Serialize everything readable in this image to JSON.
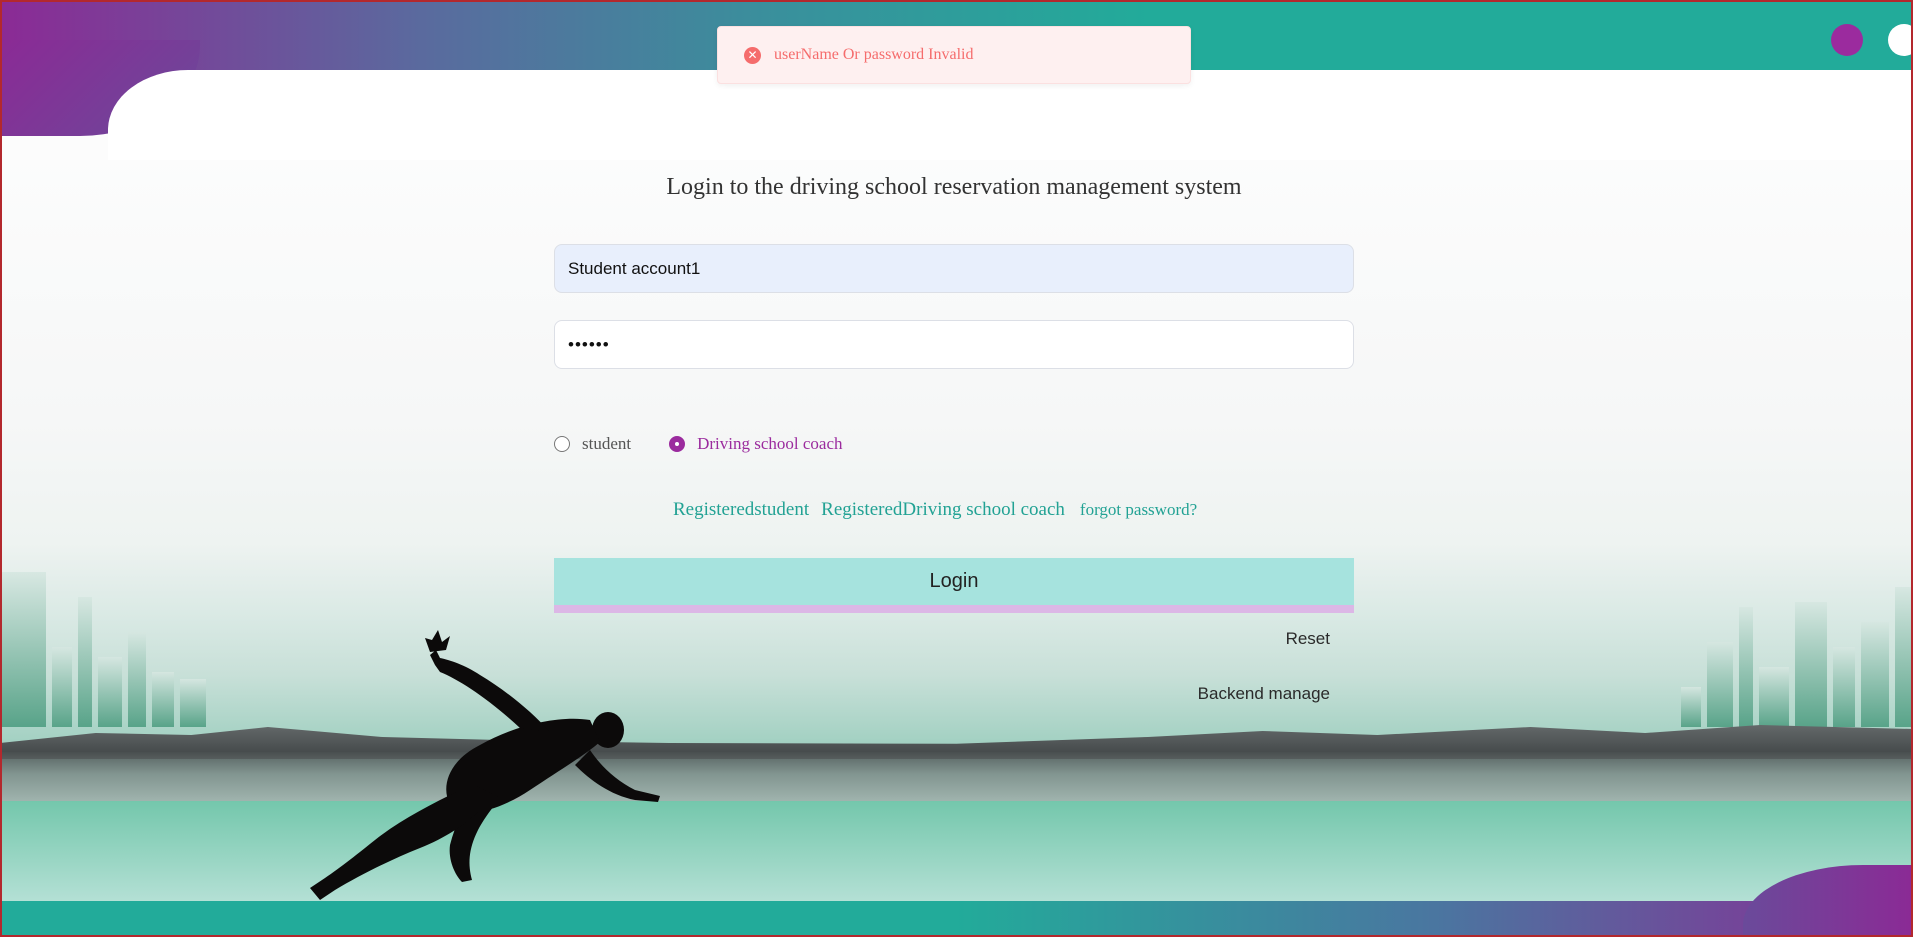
{
  "message": {
    "type": "error",
    "icon": "close-circle-icon",
    "text": "userName Or password Invalid",
    "color": "#f56c6c"
  },
  "login": {
    "title": "Login to the driving school reservation management system",
    "username_value": "Student account1",
    "password_value": "••••••",
    "roles": [
      {
        "label": "student",
        "selected": false
      },
      {
        "label": "Driving school coach",
        "selected": true
      }
    ],
    "links": [
      "Registeredstudent",
      "RegisteredDriving school coach",
      "forgot password?"
    ],
    "login_button": "Login",
    "reset_button": "Reset",
    "backend_button": "Backend manage"
  },
  "theme": {
    "accent_purple": "#9b2b9e",
    "accent_teal": "#22ab9a",
    "link_color": "#22a294",
    "button_bg": "#a6e3de"
  }
}
